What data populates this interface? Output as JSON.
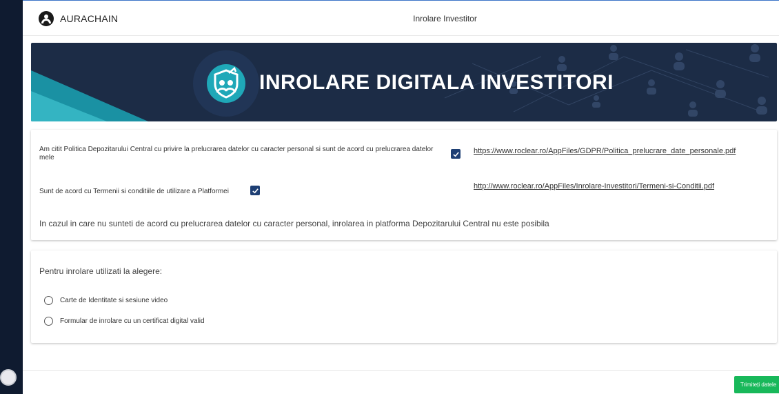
{
  "app": {
    "brand": "AURACHAIN",
    "page_title": "Inrolare Investitor"
  },
  "banner": {
    "title": "INROLARE DIGITALA INVESTITORI"
  },
  "consent": {
    "gdpr_text": "Am citit Politica Depozitarului Central cu privire la prelucrarea datelor cu caracter personal si sunt de acord cu prelucrarea datelor mele",
    "gdpr_checked": true,
    "gdpr_link": "https://www.roclear.ro/AppFiles/GDPR/Politica_prelucrare_date_personale.pdf",
    "terms_text": "Sunt de acord cu Termenii si conditiile de utilizare a Platformei",
    "terms_checked": true,
    "terms_link": "http://www.roclear.ro/AppFiles/Inrolare-Investitori/Termeni-si-Conditii.pdf",
    "info_text": "In cazul in care nu sunteti de acord cu prelucrarea datelor cu caracter personal, inrolarea in platforma Depozitarului Central nu este posibila"
  },
  "enrollment": {
    "label": "Pentru inrolare utilizati la alegere:",
    "options": [
      "Carte de Identitate si sesiune video",
      "Formular de inrolare cu un certificat digital valid"
    ]
  },
  "footer": {
    "submit_label": "Trimiteți datele"
  },
  "colors": {
    "rail": "#0f1b30",
    "banner_bg": "#1c2c46",
    "checkbox": "#1e3f74",
    "submit": "#18b85a",
    "accent_teal": "#1fa8b8"
  },
  "icons": {
    "brand_logo": "aurachain-logo-icon",
    "banner_logo": "shield-people-icon",
    "check": "checkmark-icon"
  }
}
